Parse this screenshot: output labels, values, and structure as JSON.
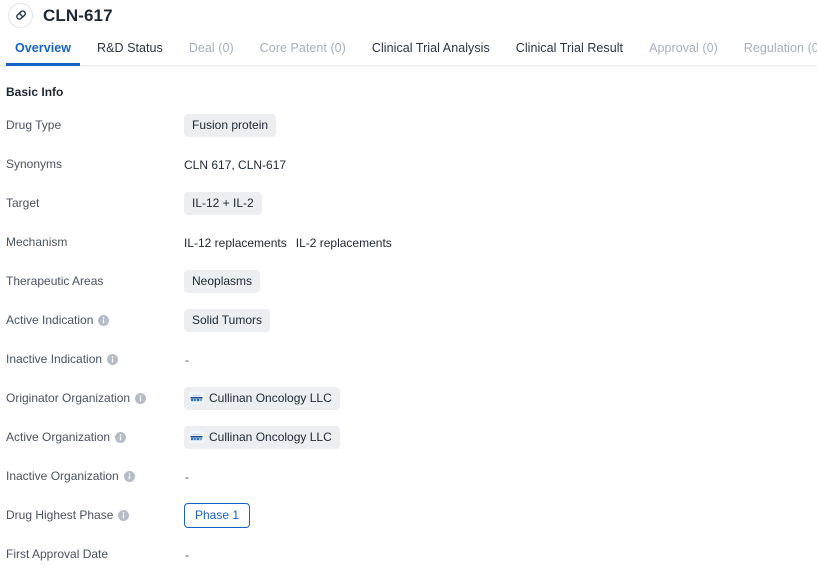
{
  "header": {
    "icon": "pill-capsule-icon",
    "title": "CLN-617"
  },
  "tabs": [
    {
      "label": "Overview",
      "state": "active"
    },
    {
      "label": "R&D Status",
      "state": "normal"
    },
    {
      "label": "Deal (0)",
      "state": "disabled"
    },
    {
      "label": "Core Patent (0)",
      "state": "disabled"
    },
    {
      "label": "Clinical Trial Analysis",
      "state": "normal"
    },
    {
      "label": "Clinical Trial Result",
      "state": "normal"
    },
    {
      "label": "Approval (0)",
      "state": "disabled"
    },
    {
      "label": "Regulation (0)",
      "state": "disabled"
    }
  ],
  "basic_info": {
    "section_title": "Basic Info",
    "fields": [
      {
        "label": "Drug Type",
        "has_info": false,
        "type": "chips",
        "values": [
          "Fusion protein"
        ]
      },
      {
        "label": "Synonyms",
        "has_info": false,
        "type": "text",
        "values": [
          "CLN 617,  CLN-617"
        ]
      },
      {
        "label": "Target",
        "has_info": false,
        "type": "chips",
        "values": [
          "IL-12 + IL-2"
        ]
      },
      {
        "label": "Mechanism",
        "has_info": false,
        "type": "text",
        "values": [
          "IL-12 replacements",
          "IL-2 replacements"
        ]
      },
      {
        "label": "Therapeutic Areas",
        "has_info": false,
        "type": "chips",
        "values": [
          "Neoplasms"
        ]
      },
      {
        "label": "Active Indication",
        "has_info": true,
        "type": "chips",
        "values": [
          "Solid Tumors"
        ]
      },
      {
        "label": "Inactive Indication",
        "has_info": true,
        "type": "empty",
        "values": [
          "-"
        ]
      },
      {
        "label": "Originator Organization",
        "has_info": true,
        "type": "org-chips",
        "values": [
          "Cullinan Oncology LLC"
        ]
      },
      {
        "label": "Active Organization",
        "has_info": true,
        "type": "org-chips",
        "values": [
          "Cullinan Oncology LLC"
        ]
      },
      {
        "label": "Inactive Organization",
        "has_info": true,
        "type": "empty",
        "values": [
          "-"
        ]
      },
      {
        "label": "Drug Highest Phase",
        "has_info": true,
        "type": "phase",
        "values": [
          "Phase 1"
        ]
      },
      {
        "label": "First Approval Date",
        "has_info": false,
        "type": "empty",
        "values": [
          "-"
        ]
      }
    ]
  },
  "colors": {
    "accent": "#1562c5",
    "chip_bg": "#eceef1",
    "text_primary": "#1d2733",
    "text_secondary": "#49525f",
    "text_disabled": "#a7afbd"
  }
}
